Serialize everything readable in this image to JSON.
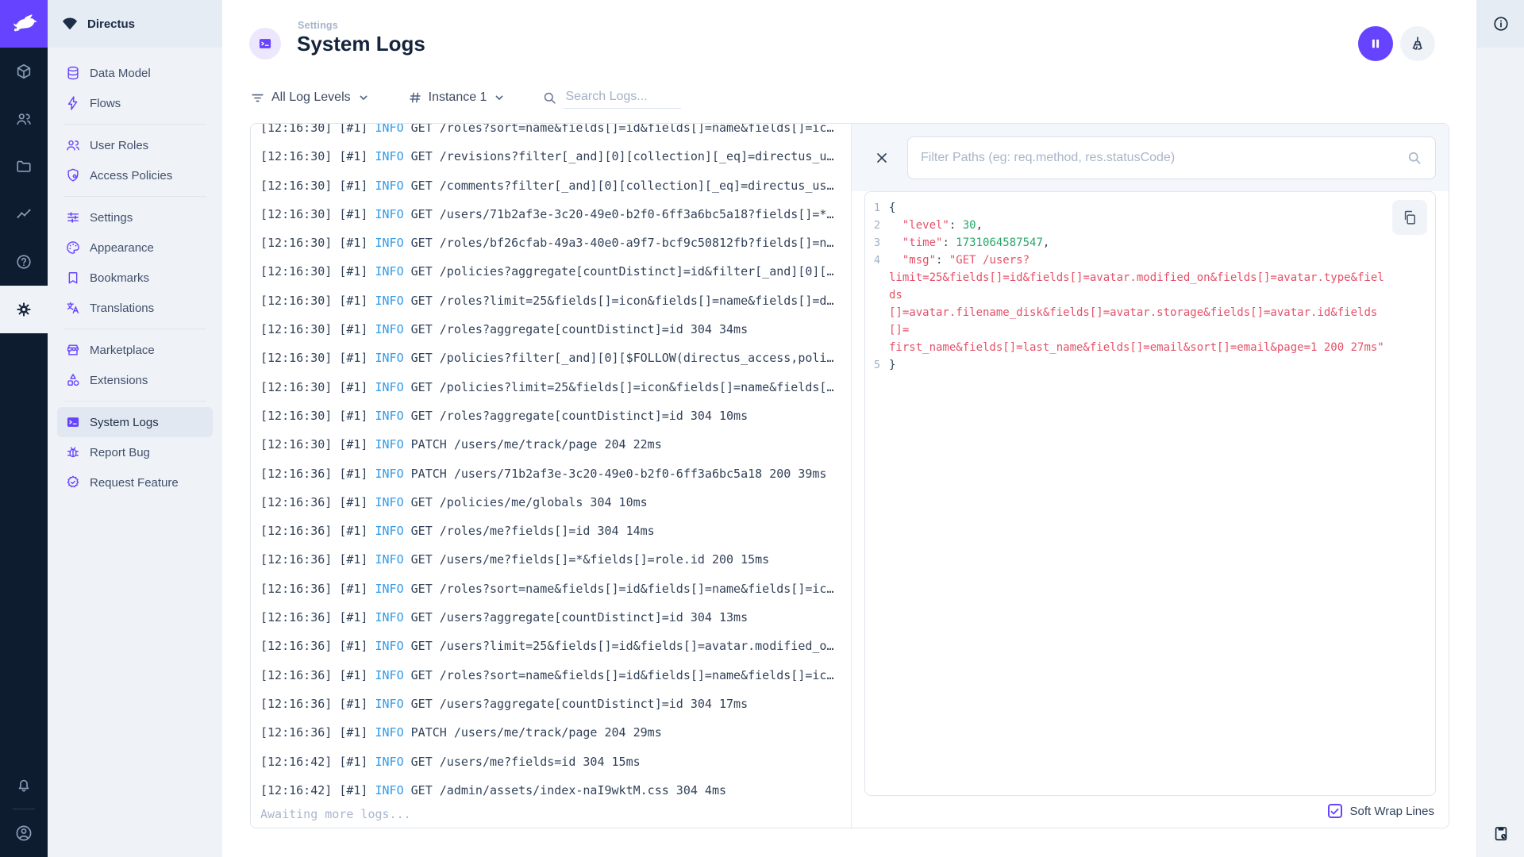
{
  "app": {
    "project_name": "Directus"
  },
  "colors": {
    "accent": "#6644ff",
    "module_bar_bg": "#0e1c2f",
    "info_level": "#2f9be8",
    "json_key": "#e35169",
    "json_number": "#27a768"
  },
  "module_bar": {
    "icons": [
      "directus-rabbit-logo",
      "cube-icon",
      "people-icon",
      "folder-icon",
      "chart-icon",
      "help-icon",
      "gear-icon",
      "bell-icon",
      "avatar-icon"
    ],
    "active": "gear-icon"
  },
  "sidebar": {
    "project": "Directus",
    "sections": [
      {
        "items": [
          {
            "label": "Data Model",
            "icon": "database"
          },
          {
            "label": "Flows",
            "icon": "bolt"
          }
        ]
      },
      {
        "items": [
          {
            "label": "User Roles",
            "icon": "people"
          },
          {
            "label": "Access Policies",
            "icon": "shield"
          }
        ]
      },
      {
        "items": [
          {
            "label": "Settings",
            "icon": "tune"
          },
          {
            "label": "Appearance",
            "icon": "palette"
          },
          {
            "label": "Bookmarks",
            "icon": "bookmark"
          },
          {
            "label": "Translations",
            "icon": "translate"
          }
        ]
      },
      {
        "items": [
          {
            "label": "Marketplace",
            "icon": "storefront"
          },
          {
            "label": "Extensions",
            "icon": "extensions"
          }
        ]
      },
      {
        "items": [
          {
            "label": "System Logs",
            "icon": "terminal",
            "active": true
          },
          {
            "label": "Report Bug",
            "icon": "bug"
          },
          {
            "label": "Request Feature",
            "icon": "feature"
          }
        ]
      }
    ]
  },
  "header": {
    "breadcrumb": "Settings",
    "title": "System Logs"
  },
  "filters": {
    "log_level": "All Log Levels",
    "instance": "Instance 1",
    "search_placeholder": "Search Logs..."
  },
  "logs": {
    "awaiting_text": "Awaiting more logs...",
    "entries": [
      {
        "time": "12:16:30",
        "inst": "#1",
        "level": "INFO",
        "msg": "GET /roles?sort=name&fields[]=id&fields[]=name&fields[]=ic…"
      },
      {
        "time": "12:16:30",
        "inst": "#1",
        "level": "INFO",
        "msg": "GET /revisions?filter[_and][0][collection][_eq]=directus_u…"
      },
      {
        "time": "12:16:30",
        "inst": "#1",
        "level": "INFO",
        "msg": "GET /comments?filter[_and][0][collection][_eq]=directus_us…"
      },
      {
        "time": "12:16:30",
        "inst": "#1",
        "level": "INFO",
        "msg": "GET /users/71b2af3e-3c20-49e0-b2f0-6ff3a6bc5a18?fields[]=*…"
      },
      {
        "time": "12:16:30",
        "inst": "#1",
        "level": "INFO",
        "msg": "GET /roles/bf26cfab-49a3-40e0-a9f7-bcf9c50812fb?fields[]=n…"
      },
      {
        "time": "12:16:30",
        "inst": "#1",
        "level": "INFO",
        "msg": "GET /policies?aggregate[countDistinct]=id&filter[_and][0][…"
      },
      {
        "time": "12:16:30",
        "inst": "#1",
        "level": "INFO",
        "msg": "GET /roles?limit=25&fields[]=icon&fields[]=name&fields[]=d…"
      },
      {
        "time": "12:16:30",
        "inst": "#1",
        "level": "INFO",
        "msg": "GET /roles?aggregate[countDistinct]=id 304 34ms"
      },
      {
        "time": "12:16:30",
        "inst": "#1",
        "level": "INFO",
        "msg": "GET /policies?filter[_and][0][$FOLLOW(directus_access,poli…"
      },
      {
        "time": "12:16:30",
        "inst": "#1",
        "level": "INFO",
        "msg": "GET /policies?limit=25&fields[]=icon&fields[]=name&fields[…"
      },
      {
        "time": "12:16:30",
        "inst": "#1",
        "level": "INFO",
        "msg": "GET /roles?aggregate[countDistinct]=id 304 10ms"
      },
      {
        "time": "12:16:30",
        "inst": "#1",
        "level": "INFO",
        "msg": "PATCH /users/me/track/page 204 22ms"
      },
      {
        "time": "12:16:36",
        "inst": "#1",
        "level": "INFO",
        "msg": "PATCH /users/71b2af3e-3c20-49e0-b2f0-6ff3a6bc5a18 200 39ms"
      },
      {
        "time": "12:16:36",
        "inst": "#1",
        "level": "INFO",
        "msg": "GET /policies/me/globals 304 10ms"
      },
      {
        "time": "12:16:36",
        "inst": "#1",
        "level": "INFO",
        "msg": "GET /roles/me?fields[]=id 304 14ms"
      },
      {
        "time": "12:16:36",
        "inst": "#1",
        "level": "INFO",
        "msg": "GET /users/me?fields[]=*&fields[]=role.id 200 15ms"
      },
      {
        "time": "12:16:36",
        "inst": "#1",
        "level": "INFO",
        "msg": "GET /roles?sort=name&fields[]=id&fields[]=name&fields[]=ic…"
      },
      {
        "time": "12:16:36",
        "inst": "#1",
        "level": "INFO",
        "msg": "GET /users?aggregate[countDistinct]=id 304 13ms"
      },
      {
        "time": "12:16:36",
        "inst": "#1",
        "level": "INFO",
        "msg": "GET /users?limit=25&fields[]=id&fields[]=avatar.modified_o…"
      },
      {
        "time": "12:16:36",
        "inst": "#1",
        "level": "INFO",
        "msg": "GET /roles?sort=name&fields[]=id&fields[]=name&fields[]=ic…"
      },
      {
        "time": "12:16:36",
        "inst": "#1",
        "level": "INFO",
        "msg": "GET /users?aggregate[countDistinct]=id 304 17ms"
      },
      {
        "time": "12:16:36",
        "inst": "#1",
        "level": "INFO",
        "msg": "PATCH /users/me/track/page 204 29ms"
      },
      {
        "time": "12:16:42",
        "inst": "#1",
        "level": "INFO",
        "msg": "GET /users/me?fields=id 304 15ms"
      },
      {
        "time": "12:16:42",
        "inst": "#1",
        "level": "INFO",
        "msg": "GET /admin/assets/index-naI9wktM.css 304 4ms"
      }
    ]
  },
  "detail": {
    "filter_placeholder": "Filter Paths (eg: req.method, res.statusCode)",
    "soft_wrap_label": "Soft Wrap Lines",
    "soft_wrap_checked": true,
    "code": {
      "json": {
        "level": 30,
        "time": 1731064587547,
        "msg": "GET /users?limit=25&fields[]=id&fields[]=avatar.modified_on&fields[]=avatar.type&fields[]=avatar.filename_disk&fields[]=avatar.storage&fields[]=avatar.id&fields[]=first_name&fields[]=last_name&fields[]=email&sort[]=email&page=1 200 27ms"
      },
      "rows": [
        {
          "n": "1",
          "tokens": [
            {
              "t": "punct",
              "v": "{"
            }
          ]
        },
        {
          "n": "2",
          "tokens": [
            {
              "t": "punct",
              "v": "  "
            },
            {
              "t": "key",
              "v": "\"level\""
            },
            {
              "t": "punct",
              "v": ": "
            },
            {
              "t": "num",
              "v": "30"
            },
            {
              "t": "punct",
              "v": ","
            }
          ]
        },
        {
          "n": "3",
          "tokens": [
            {
              "t": "punct",
              "v": "  "
            },
            {
              "t": "key",
              "v": "\"time\""
            },
            {
              "t": "punct",
              "v": ": "
            },
            {
              "t": "num",
              "v": "1731064587547"
            },
            {
              "t": "punct",
              "v": ","
            }
          ]
        },
        {
          "n": "4",
          "tokens": [
            {
              "t": "punct",
              "v": "  "
            },
            {
              "t": "key",
              "v": "\"msg\""
            },
            {
              "t": "punct",
              "v": ": "
            },
            {
              "t": "str",
              "v": "\"GET /users?"
            }
          ]
        },
        {
          "n": "",
          "tokens": [
            {
              "t": "str",
              "v": "limit=25&fields[]=id&fields[]=avatar.modified_on&fields[]=avatar.type&fields"
            }
          ]
        },
        {
          "n": "",
          "tokens": [
            {
              "t": "str",
              "v": "[]=avatar.filename_disk&fields[]=avatar.storage&fields[]=avatar.id&fields[]="
            }
          ]
        },
        {
          "n": "",
          "tokens": [
            {
              "t": "str",
              "v": "first_name&fields[]=last_name&fields[]=email&sort[]=email&page=1 200 27ms\""
            }
          ]
        },
        {
          "n": "5",
          "tokens": [
            {
              "t": "punct",
              "v": "}"
            }
          ]
        }
      ]
    }
  }
}
